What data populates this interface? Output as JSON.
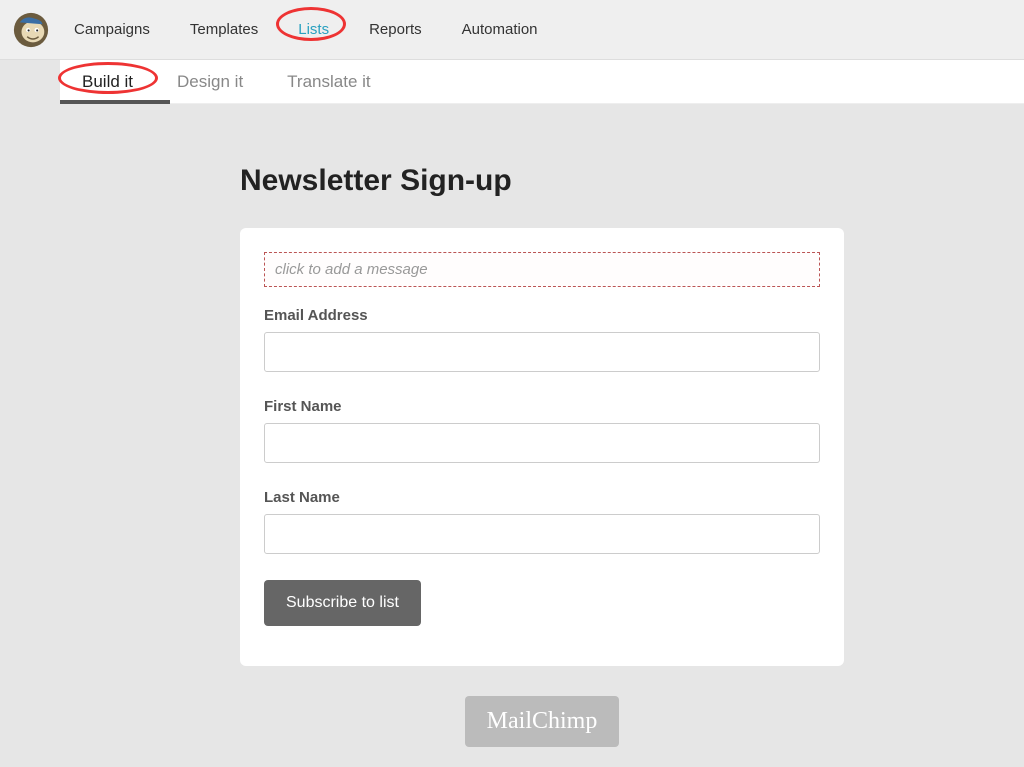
{
  "topnav": {
    "items": [
      {
        "label": "Campaigns"
      },
      {
        "label": "Templates"
      },
      {
        "label": "Lists",
        "active": true
      },
      {
        "label": "Reports"
      },
      {
        "label": "Automation"
      }
    ]
  },
  "subnav": {
    "items": [
      {
        "label": "Build it",
        "active": true
      },
      {
        "label": "Design it"
      },
      {
        "label": "Translate it"
      }
    ]
  },
  "form": {
    "title": "Newsletter Sign-up",
    "message_placeholder": "click to add a message",
    "fields": [
      {
        "label": "Email Address"
      },
      {
        "label": "First Name"
      },
      {
        "label": "Last Name"
      }
    ],
    "submit_label": "Subscribe to list"
  },
  "footer": {
    "brand": "MailChimp"
  }
}
